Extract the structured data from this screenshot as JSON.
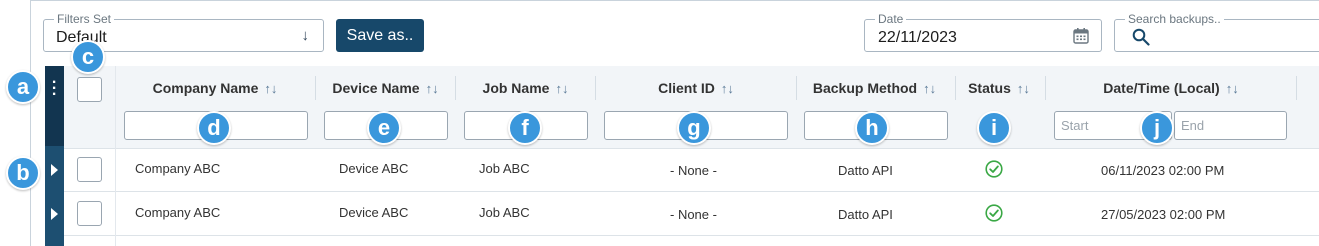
{
  "filters_set": {
    "label": "Filters Set",
    "value": "Default",
    "arrow": "arrow-down-icon"
  },
  "save_as": {
    "label": "Save as.."
  },
  "date": {
    "label": "Date",
    "value": "22/11/2023",
    "icon": "calendar-icon"
  },
  "search": {
    "placeholder": "Search backups..",
    "icon": "search-icon"
  },
  "columns": [
    {
      "label": "Company Name",
      "sort_icon": "sort-icon"
    },
    {
      "label": "Device Name",
      "sort_icon": "sort-icon"
    },
    {
      "label": "Job Name",
      "sort_icon": "sort-icon"
    },
    {
      "label": "Client ID",
      "sort_icon": "sort-icon"
    },
    {
      "label": "Backup Method",
      "sort_icon": "sort-icon"
    },
    {
      "label": "Status",
      "sort_icon": "sort-icon"
    },
    {
      "label": "Date/Time (Local)",
      "sort_icon": "sort-icon"
    }
  ],
  "sort_glyph": "↑↓",
  "datetime_filter": {
    "start_placeholder": "Start",
    "end_placeholder": "End"
  },
  "rows": [
    {
      "company": "Company ABC",
      "device": "Device ABC",
      "job": "Job ABC",
      "client_id": "- None -",
      "method": "Datto API",
      "status": "success",
      "datetime": "06/11/2023 02:00 PM"
    },
    {
      "company": "Company ABC",
      "device": "Device ABC",
      "job": "Job ABC",
      "client_id": "- None -",
      "method": "Datto API",
      "status": "success",
      "datetime": "27/05/2023 02:00 PM"
    }
  ],
  "callouts": [
    "a",
    "b",
    "c",
    "d",
    "e",
    "f",
    "g",
    "h",
    "i",
    "j"
  ],
  "colors": {
    "accent": "#17486a",
    "sidebar": "#1d4f71",
    "success": "#3aa845",
    "callout": "#3a97dc"
  }
}
